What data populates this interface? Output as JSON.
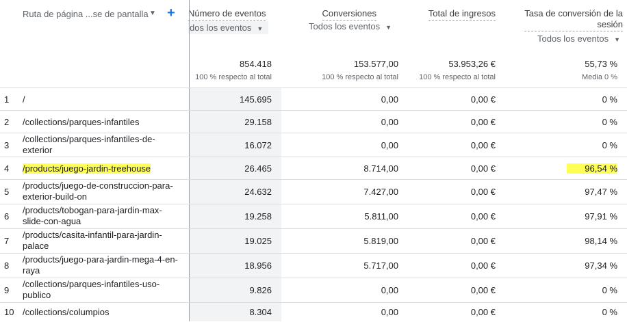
{
  "header": {
    "dimension_label": "Ruta de página ...se de pantalla",
    "add_symbol": "+",
    "columns": [
      {
        "title": "Número de eventos",
        "selector": "dos los eventos",
        "total": "854.418",
        "total_sub": "100 % respecto al total"
      },
      {
        "title": "Conversiones",
        "selector": "Todos los eventos",
        "total": "153.577,00",
        "total_sub": "100 % respecto al total"
      },
      {
        "title": "Total de ingresos",
        "selector": "",
        "total": "53.953,26 €",
        "total_sub": "100 % respecto al total"
      },
      {
        "title_line1": "Tasa de conversión de la",
        "title_line2": "sesión",
        "selector": "Todos los eventos",
        "total": "55,73 %",
        "total_sub": "Media 0 %"
      }
    ]
  },
  "rows": [
    {
      "idx": "1",
      "path": "/",
      "events": "145.695",
      "conversions": "0,00",
      "revenue": "0,00 €",
      "rate": "0 %"
    },
    {
      "idx": "2",
      "path": "/collections/parques-infantiles",
      "events": "29.158",
      "conversions": "0,00",
      "revenue": "0,00 €",
      "rate": "0 %"
    },
    {
      "idx": "3",
      "path": "/collections/parques-infantiles-de-exterior",
      "events": "16.072",
      "conversions": "0,00",
      "revenue": "0,00 €",
      "rate": "0 %"
    },
    {
      "idx": "4",
      "path": "/products/juego-jardin-treehouse",
      "events": "26.465",
      "conversions": "8.714,00",
      "revenue": "0,00 €",
      "rate": "96,54 %"
    },
    {
      "idx": "5",
      "path": "/products/juego-de-construccion-para-exterior-build-on",
      "events": "24.632",
      "conversions": "7.427,00",
      "revenue": "0,00 €",
      "rate": "97,47 %"
    },
    {
      "idx": "6",
      "path": "/products/tobogan-para-jardin-max-slide-con-agua",
      "events": "19.258",
      "conversions": "5.811,00",
      "revenue": "0,00 €",
      "rate": "97,91 %"
    },
    {
      "idx": "7",
      "path": "/products/casita-infantil-para-jardin-palace",
      "events": "19.025",
      "conversions": "5.819,00",
      "revenue": "0,00 €",
      "rate": "98,14 %"
    },
    {
      "idx": "8",
      "path": "/products/juego-para-jardin-mega-4-en-raya",
      "events": "18.956",
      "conversions": "5.717,00",
      "revenue": "0,00 €",
      "rate": "97,34 %"
    },
    {
      "idx": "9",
      "path": "/collections/parques-infantiles-uso-publico",
      "events": "9.826",
      "conversions": "0,00",
      "revenue": "0,00 €",
      "rate": "0 %"
    },
    {
      "idx": "10",
      "path": "/collections/columpios",
      "events": "8.304",
      "conversions": "0,00",
      "revenue": "0,00 €",
      "rate": "0 %"
    }
  ],
  "colors": {
    "highlight": "#ffff54",
    "accent": "#1a73e8"
  }
}
